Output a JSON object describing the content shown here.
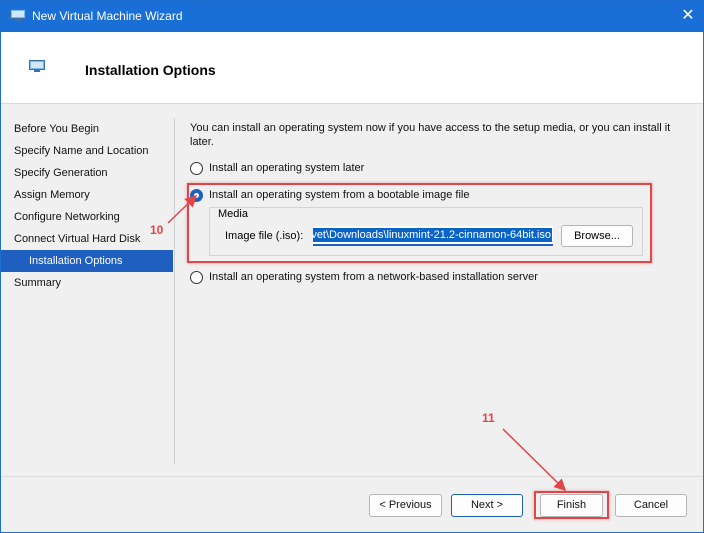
{
  "window": {
    "title": "New Virtual Machine Wizard",
    "close_glyph": "✕"
  },
  "header": {
    "title": "Installation Options"
  },
  "steps": [
    {
      "label": "Before You Begin",
      "active": false
    },
    {
      "label": "Specify Name and Location",
      "active": false
    },
    {
      "label": "Specify Generation",
      "active": false
    },
    {
      "label": "Assign Memory",
      "active": false
    },
    {
      "label": "Configure Networking",
      "active": false
    },
    {
      "label": "Connect Virtual Hard Disk",
      "active": false
    },
    {
      "label": "Installation Options",
      "active": true
    },
    {
      "label": "Summary",
      "active": false
    }
  ],
  "content": {
    "description": "You can install an operating system now if you have access to the setup media, or you can install it later.",
    "options": [
      {
        "label": "Install an operating system later",
        "checked": false
      },
      {
        "label": "Install an operating system from a bootable image file",
        "checked": true
      },
      {
        "label": "Install an operating system from a network-based installation server",
        "checked": false
      }
    ],
    "media": {
      "legend": "Media",
      "image_file_label": "Image file (.iso):",
      "image_file_value": "vet\\Downloads\\linuxmint-21.2-cinnamon-64bit.iso",
      "browse_label": "Browse..."
    }
  },
  "annotations": {
    "step10": "10",
    "step11": "11",
    "color": "#e0454a"
  },
  "buttons": {
    "previous": "< Previous",
    "next": "Next >",
    "finish": "Finish",
    "cancel": "Cancel"
  },
  "colors": {
    "titlebar": "#1a6fd6",
    "selection": "#1f5fbf"
  },
  "icons": {
    "app": "vm-window-icon",
    "close": "close-icon"
  }
}
